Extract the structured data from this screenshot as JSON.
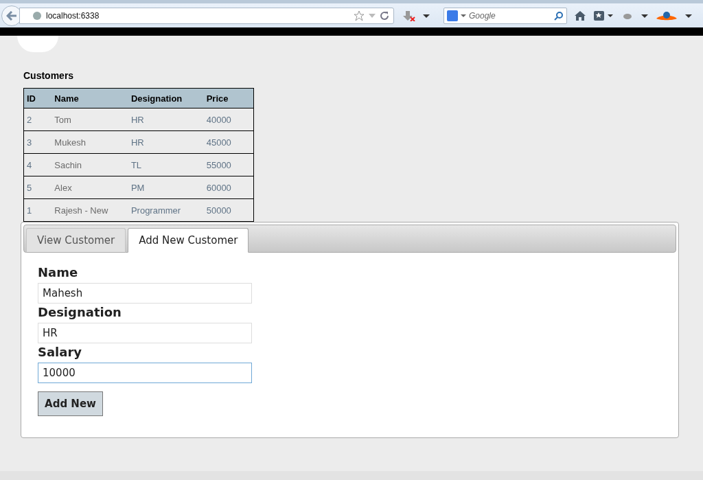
{
  "browser": {
    "address": "localhost:6338",
    "search_placeholder": "Google"
  },
  "customers": {
    "title": "Customers",
    "columns": [
      "ID",
      "Name",
      "Designation",
      "Price"
    ],
    "rows": [
      [
        "2",
        "Tom",
        "HR",
        "40000"
      ],
      [
        "3",
        "Mukesh",
        "HR",
        "45000"
      ],
      [
        "4",
        "Sachin",
        "TL",
        "55000"
      ],
      [
        "5",
        "Alex",
        "PM",
        "60000"
      ],
      [
        "1",
        "Rajesh - New",
        "Programmer",
        "50000"
      ]
    ]
  },
  "tabs": [
    {
      "label": "View Customer",
      "selected": false
    },
    {
      "label": "Add New Customer",
      "selected": true
    }
  ],
  "form": {
    "fields": [
      {
        "label": "Name",
        "value": "Mahesh",
        "focused": false
      },
      {
        "label": "Designation",
        "value": "HR",
        "focused": false
      },
      {
        "label": "Salary",
        "value": "10000",
        "focused": true
      }
    ],
    "button": "Add New"
  }
}
